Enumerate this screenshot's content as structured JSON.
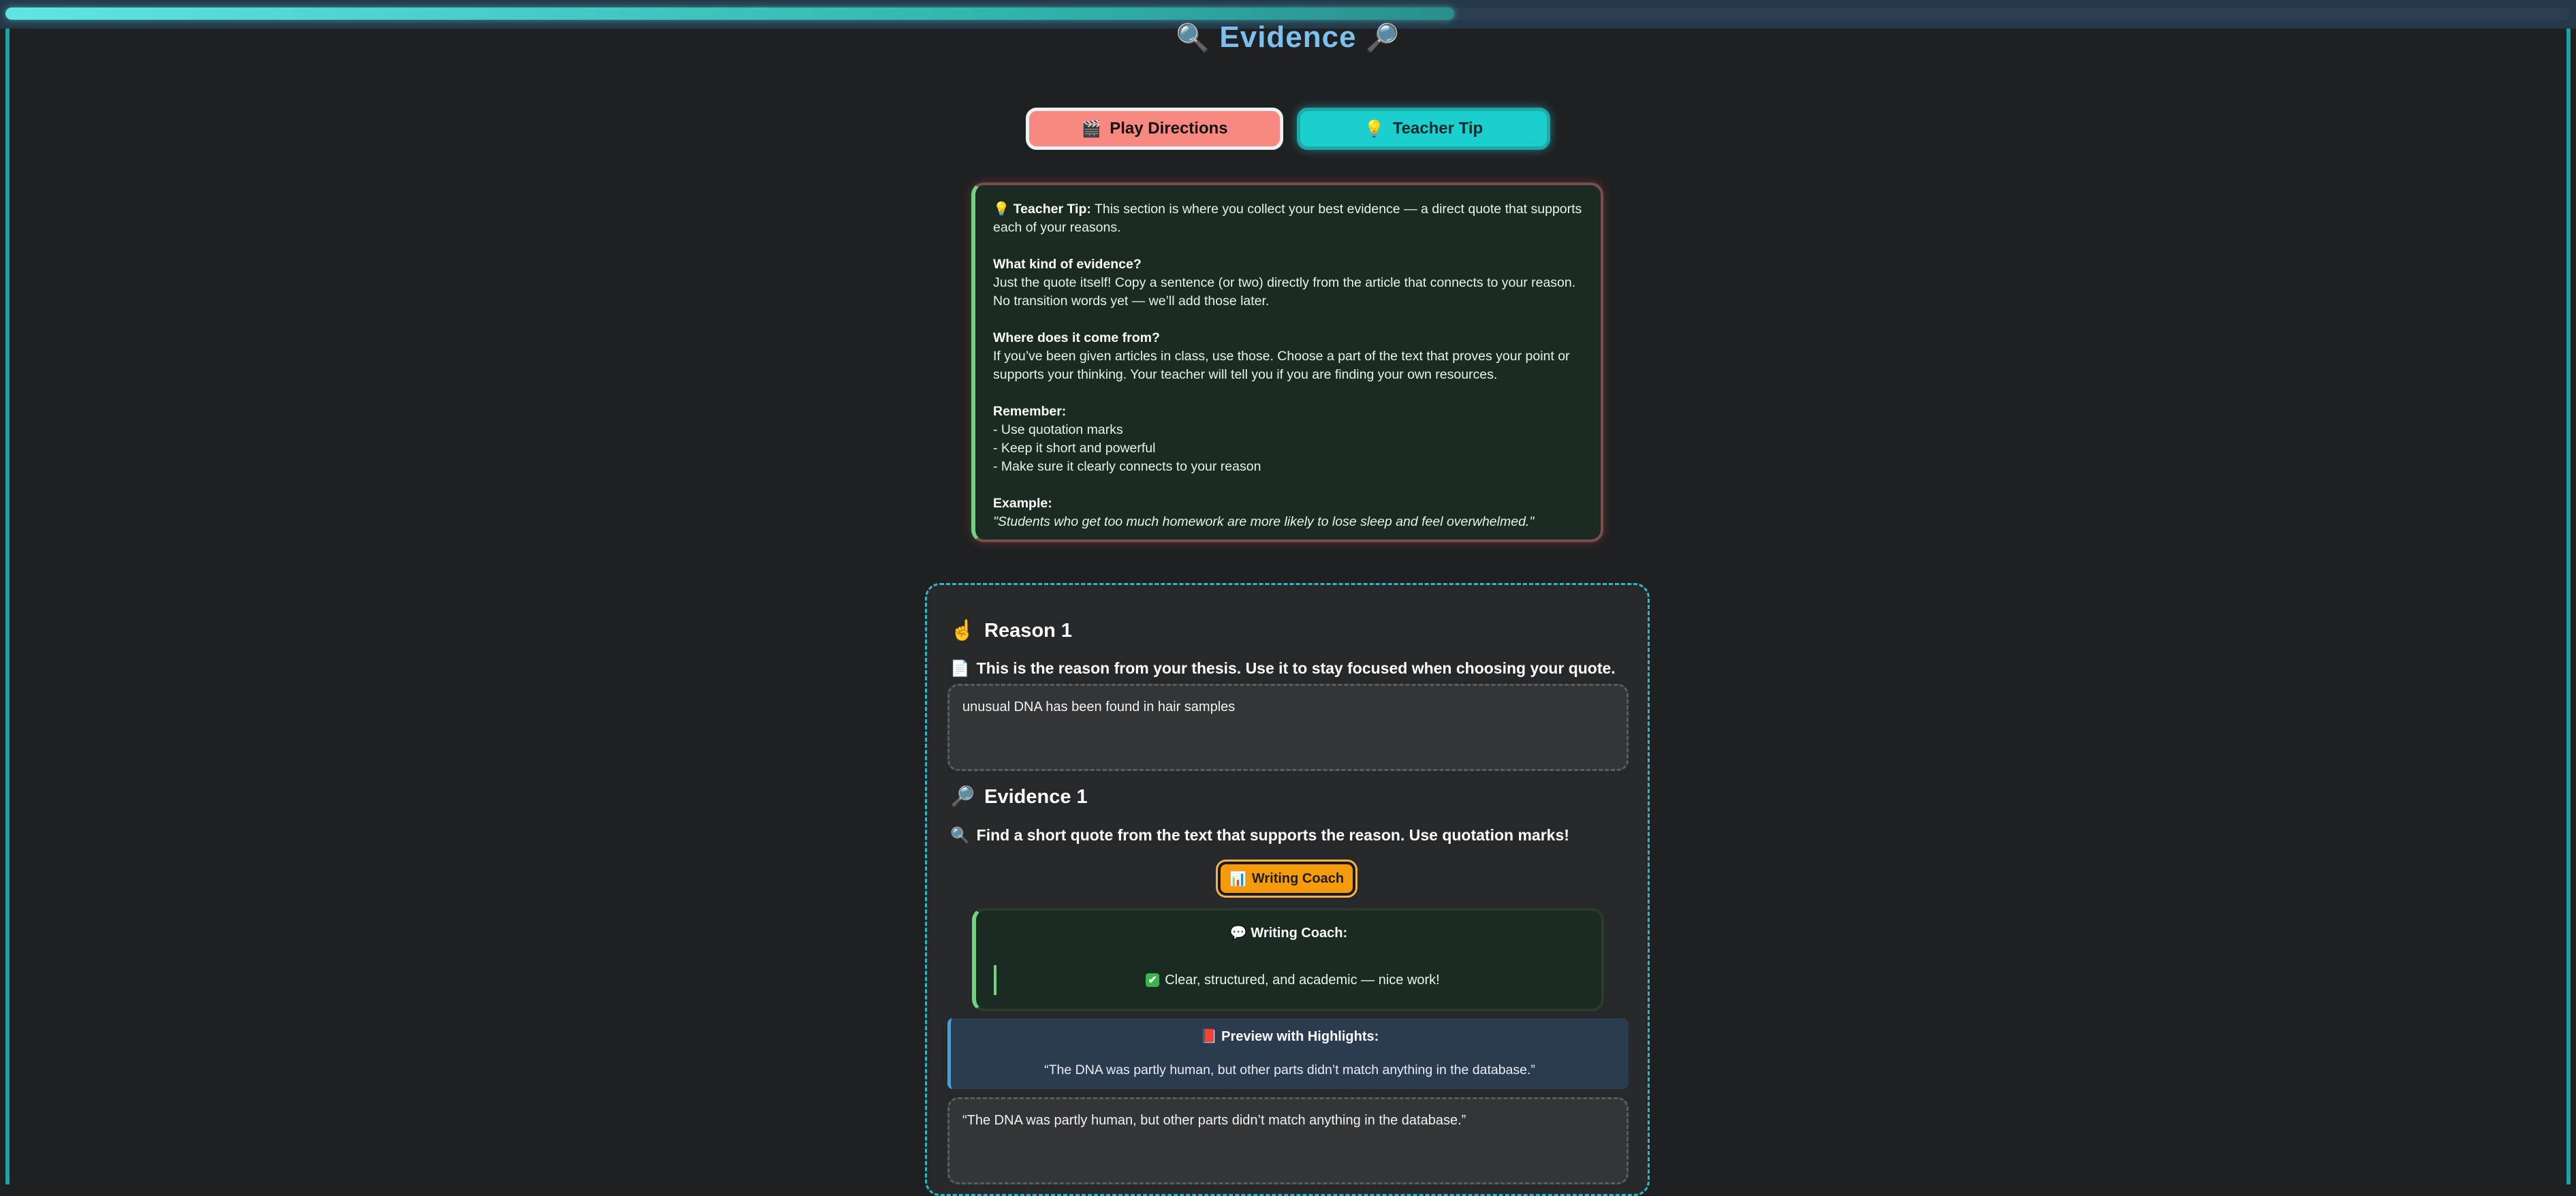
{
  "progress": {
    "fraction": 0.565
  },
  "header": {
    "title": "Evidence",
    "left_icon": "🔍",
    "right_icon": "🔎"
  },
  "buttons": {
    "play_directions": {
      "icon": "🎬",
      "label": "Play Directions"
    },
    "teacher_tip": {
      "icon": "💡",
      "label": "Teacher Tip"
    }
  },
  "teacher_tip": {
    "icon": "💡",
    "lead": "Teacher Tip:",
    "intro": "This section is where you collect your best evidence — a direct quote that supports each of your reasons.",
    "kind_heading": "What kind of evidence?",
    "kind_text": "Just the quote itself! Copy a sentence (or two) directly from the article that connects to your reason. No transition words yet — we’ll add those later.",
    "source_heading": "Where does it come from?",
    "source_text": "If you’ve been given articles in class, use those. Choose a part of the text that proves your point or supports your thinking. Your teacher will tell you if you are finding your own resources.",
    "remember_heading": "Remember:",
    "remember_items": [
      "- Use quotation marks",
      "- Keep it short and powerful",
      "- Make sure it clearly connects to your reason"
    ],
    "example_heading": "Example:",
    "example_text": "\"Students who get too much homework are more likely to lose sleep and feel overwhelmed.\""
  },
  "reason": {
    "icon": "☝️",
    "title": "Reason 1",
    "hint_icon": "📄",
    "hint": "This is the reason from your thesis. Use it to stay focused when choosing your quote.",
    "value": "unusual DNA has been found in hair samples"
  },
  "evidence": {
    "icon": "🔎",
    "title": "Evidence 1",
    "hint_icon": "🔍",
    "hint": "Find a short quote from the text that supports the reason. Use quotation marks!",
    "coach_button_icon": "📊",
    "coach_button": "Writing Coach",
    "coach_title_icon": "💬",
    "coach_title": "Writing Coach:",
    "coach_feedback_icon": "✔",
    "coach_feedback": "Clear, structured, and academic — nice work!",
    "preview_icon": "📕",
    "preview_title": "Preview with Highlights:",
    "preview_text": "“The DNA was partly human, but other parts didn’t match anything in the database.”",
    "value": "“The DNA was partly human, but other parts didn’t match anything in the database.”"
  }
}
